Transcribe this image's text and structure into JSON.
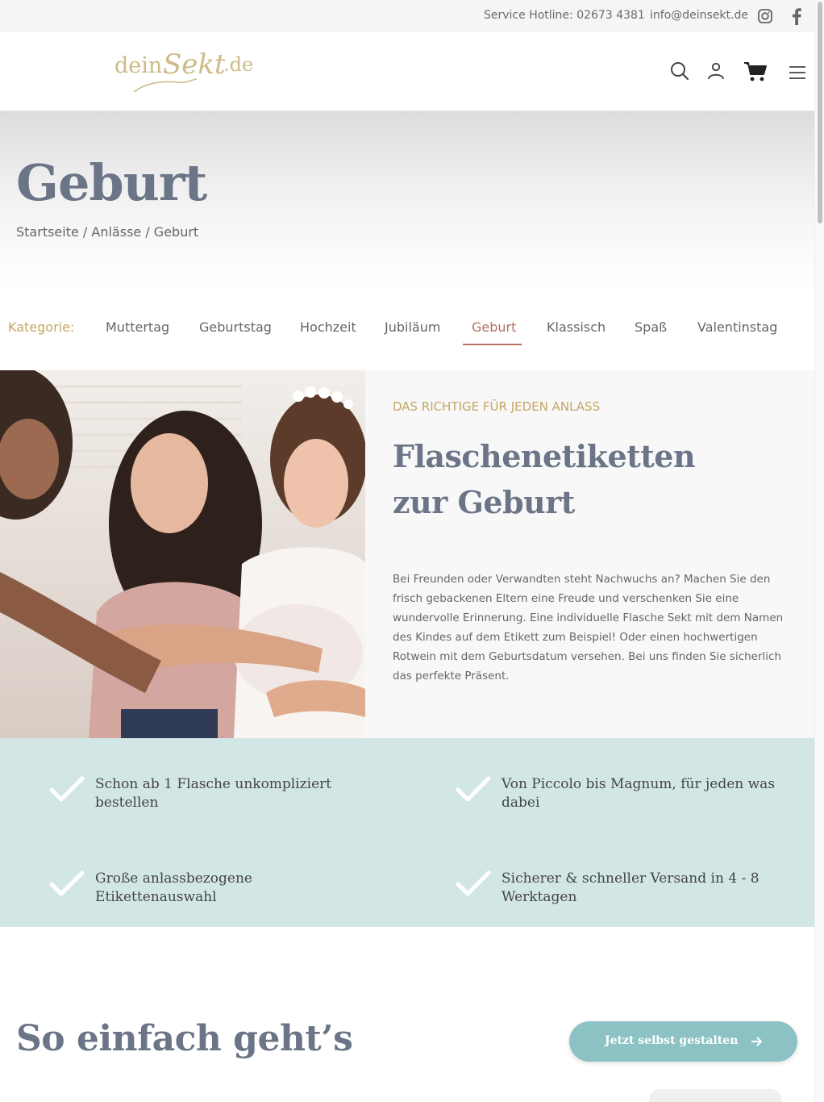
{
  "topbar": {
    "hotline": "Service Hotline:  02673 4381",
    "email": "info@deinsekt.de",
    "icons": [
      "instagram-icon",
      "facebook-icon"
    ]
  },
  "header": {
    "logo": {
      "part1": "dein",
      "part2": "Sekt",
      "part3": ".de"
    },
    "icons": [
      "search-icon",
      "user-icon",
      "cart-icon",
      "menu-icon"
    ]
  },
  "hero": {
    "title": "Geburt",
    "breadcrumb": "Startseite / Anlässe / Geburt"
  },
  "categories": {
    "label": "Kategorie:",
    "items": [
      "Muttertag",
      "Geburtstag",
      "Hochzeit",
      "Jubiläum",
      "Geburt",
      "Klassisch",
      "Spaß",
      "Valentinstag"
    ],
    "active": "Geburt"
  },
  "feature": {
    "kicker": "DAS RICHTIGE FÜR JEDEN ANLASS",
    "title_line1": "Flaschenetiketten",
    "title_line2": "zur Geburt",
    "text": "Bei Freunden oder Verwandten steht Nachwuchs an? Machen Sie den frisch gebackenen Eltern eine Freude und verschenken Sie eine wundervolle Erinnerung. Eine individuelle Flasche Sekt mit dem Namen des Kindes auf dem Etikett zum Beispiel! Oder einen hochwertigen Rotwein mit dem Geburtsdatum versehen. Bei uns finden Sie sicherlich das perfekte Präsent."
  },
  "benefits": [
    "Schon ab 1 Flasche unkompliziert bestellen",
    "Von Piccolo bis Magnum, für jeden was dabei",
    "Große anlassbezogene Etikettenauswahl",
    "Sicherer & schneller Versand in 4 - 8 Werktagen"
  ],
  "how": {
    "title": "So einfach geht’s",
    "cta": "Jetzt selbst gestalten"
  },
  "colors": {
    "gold": "#c3a763",
    "slate": "#6b7587",
    "rose": "#b56f5f",
    "mint": "#d3e6e6",
    "teal_button": "#8cc2c4"
  }
}
